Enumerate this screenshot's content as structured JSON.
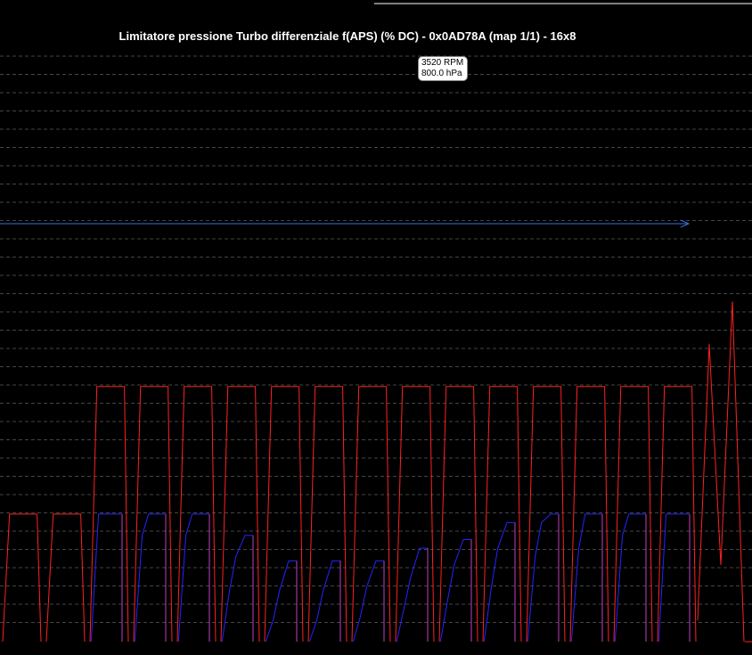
{
  "chart_data": {
    "type": "line",
    "title": "Limitatore pressione Turbo differenziale f(APS) (% DC) - 0x0AD78A (map 1/1) - 16x8",
    "tooltip": {
      "rpm": "3520 RPM",
      "pressure": "800.0 hPa"
    },
    "x_units": "map axis index (16 columns x 8 rows)",
    "ylim": [
      0,
      100
    ],
    "grid": "horizontal-dashed",
    "colors": {
      "background": "#000000",
      "grid": "#8a8a8a",
      "line_red": "#ff2020",
      "line_blue": "#2424ff",
      "cursor": "#3a6fd8",
      "title": "#ffffff"
    },
    "cycles": [
      {
        "values": [
          0,
          30,
          30,
          30,
          30,
          30,
          30,
          0
        ],
        "mode": "red"
      },
      {
        "values": [
          0,
          30,
          30,
          30,
          30,
          30,
          30,
          0
        ],
        "mode": "red"
      },
      {
        "values": [
          0,
          60,
          60,
          60,
          60,
          60,
          60,
          0
        ],
        "upper": [
          30,
          30,
          30
        ],
        "mode": "split"
      },
      {
        "values": [
          0,
          60,
          60,
          60,
          60,
          60,
          60,
          0
        ],
        "upper": [
          25,
          30,
          30
        ],
        "mode": "split"
      },
      {
        "values": [
          0,
          60,
          60,
          60,
          60,
          60,
          60,
          0
        ],
        "upper": [
          25,
          30,
          30
        ],
        "mode": "split"
      },
      {
        "values": [
          0,
          60,
          60,
          60,
          60,
          60,
          60,
          0
        ],
        "upper": [
          12,
          20,
          25
        ],
        "mode": "split"
      },
      {
        "values": [
          0,
          60,
          60,
          60,
          60,
          60,
          60,
          0
        ],
        "upper": [
          5,
          12,
          19
        ],
        "mode": "split"
      },
      {
        "values": [
          0,
          60,
          60,
          60,
          60,
          60,
          60,
          0
        ],
        "upper": [
          5,
          12,
          19
        ],
        "mode": "split"
      },
      {
        "values": [
          0,
          60,
          60,
          60,
          60,
          60,
          60,
          0
        ],
        "upper": [
          6,
          13,
          19
        ],
        "mode": "split"
      },
      {
        "values": [
          0,
          60,
          60,
          60,
          60,
          60,
          60,
          0
        ],
        "upper": [
          8,
          15,
          22
        ],
        "mode": "split"
      },
      {
        "values": [
          0,
          60,
          60,
          60,
          60,
          60,
          60,
          0
        ],
        "upper": [
          10,
          18,
          24
        ],
        "mode": "split"
      },
      {
        "values": [
          0,
          60,
          60,
          60,
          60,
          60,
          60,
          0
        ],
        "upper": [
          13,
          22,
          28
        ],
        "mode": "split"
      },
      {
        "values": [
          0,
          60,
          60,
          60,
          60,
          60,
          60,
          0
        ],
        "upper": [
          20,
          28,
          30
        ],
        "mode": "split"
      },
      {
        "values": [
          0,
          60,
          60,
          60,
          60,
          60,
          60,
          0
        ],
        "upper": [
          22,
          30,
          30
        ],
        "mode": "split"
      },
      {
        "values": [
          0,
          60,
          60,
          60,
          60,
          60,
          60,
          0
        ],
        "upper": [
          25,
          30,
          30
        ],
        "mode": "split"
      },
      {
        "values": [
          0,
          60,
          60,
          60,
          60,
          60,
          60,
          0
        ],
        "upper": [
          30,
          30,
          30
        ],
        "mode": "split"
      }
    ],
    "tail": [
      5,
      70,
      18,
      80,
      0
    ]
  }
}
